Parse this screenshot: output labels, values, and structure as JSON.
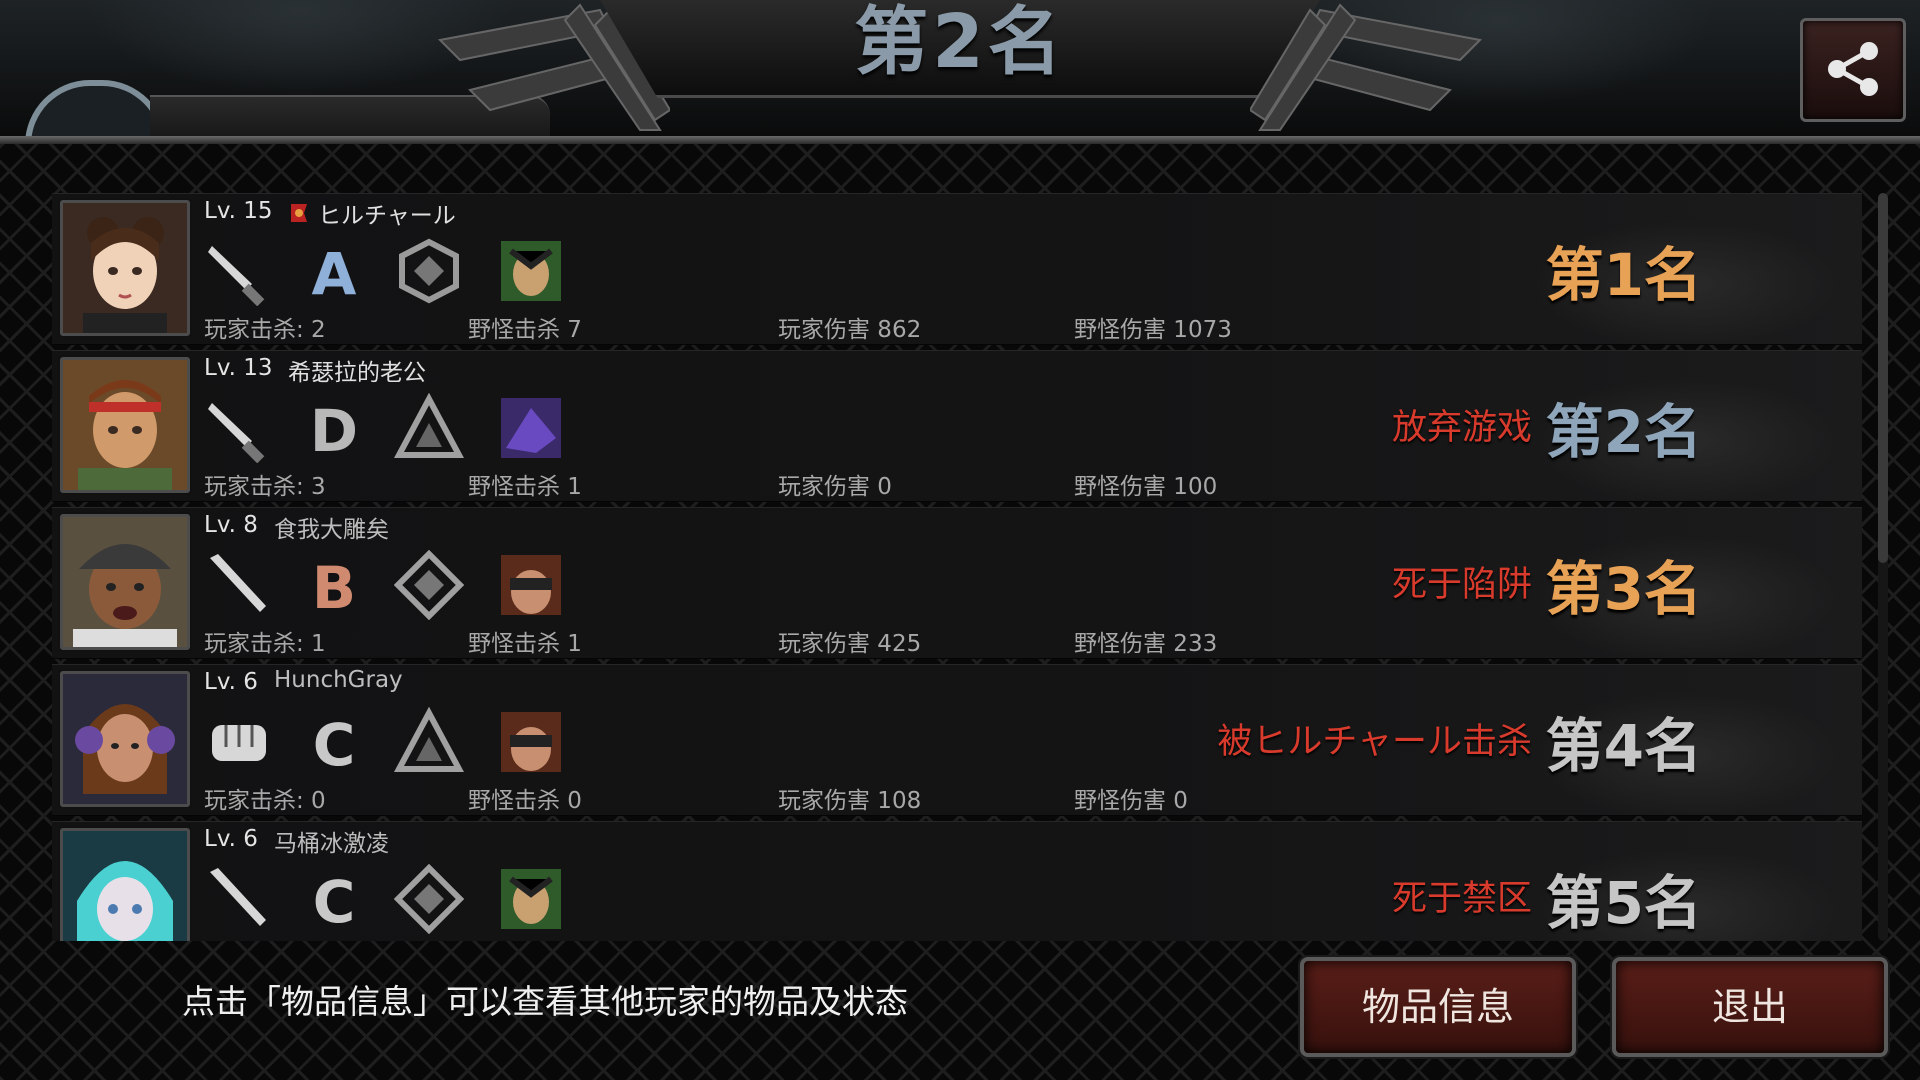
{
  "header": {
    "title": "第2名"
  },
  "players": [
    {
      "level": "Lv. 15",
      "name": "ヒルチャール",
      "has_flag": true,
      "icons": [
        "knife-icon",
        "grade-A",
        "cube-emblem-icon",
        "pet-portrait-icon"
      ],
      "grade": "A",
      "player_kills": "玩家击杀: 2",
      "monster_kills": "野怪击杀 7",
      "player_damage": "玩家伤害 862",
      "monster_damage": "野怪伤害 1073",
      "status": "",
      "rank": "第1名",
      "rank_color": "#e7a256"
    },
    {
      "level": "Lv. 13",
      "name": "希瑟拉的老公",
      "icons": [
        "knife-icon",
        "grade-D",
        "triangle-emblem-icon",
        "beast-portrait-icon"
      ],
      "grade": "D",
      "player_kills": "玩家击杀: 3",
      "monster_kills": "野怪击杀 1",
      "player_damage": "玩家伤害 0",
      "monster_damage": "野怪伤害 100",
      "status": "放弃游戏",
      "rank": "第2名",
      "rank_color": "#8fa5ba"
    },
    {
      "level": "Lv. 8",
      "name": "食我大雕矣",
      "icons": [
        "bat-icon",
        "grade-B",
        "diamond-emblem-icon",
        "goggles-portrait-icon"
      ],
      "grade": "B",
      "player_kills": "玩家击杀: 1",
      "monster_kills": "野怪击杀 1",
      "player_damage": "玩家伤害 425",
      "monster_damage": "野怪伤害 233",
      "status": "死于陷阱",
      "rank": "第3名",
      "rank_color": "#e7a256"
    },
    {
      "level": "Lv. 6",
      "name": "HunchGray",
      "icons": [
        "fist-icon",
        "grade-C",
        "triangle-emblem-icon",
        "goggles-portrait-icon"
      ],
      "grade": "C",
      "player_kills": "玩家击杀: 0",
      "monster_kills": "野怪击杀 0",
      "player_damage": "玩家伤害 108",
      "monster_damage": "野怪伤害 0",
      "status": "被ヒルチャール击杀",
      "rank": "第4名",
      "rank_color": "#c6c6c6"
    },
    {
      "level": "Lv. 6",
      "name": "马桶冰激凌",
      "icons": [
        "bat-icon",
        "grade-C",
        "diamond-emblem-icon",
        "pet-portrait-icon"
      ],
      "grade": "C",
      "player_kills": "",
      "monster_kills": "",
      "player_damage": "",
      "monster_damage": "",
      "status": "死于禁区",
      "rank": "第5名",
      "rank_color": "#c6c6c6"
    }
  ],
  "footer": {
    "tip": "点击「物品信息」可以查看其他玩家的物品及状态",
    "info_button": "物品信息",
    "exit_button": "退出"
  },
  "colors": {
    "status_red": "#d83a2c",
    "gold": "#e7a256",
    "button_red": "#5a1e18"
  }
}
